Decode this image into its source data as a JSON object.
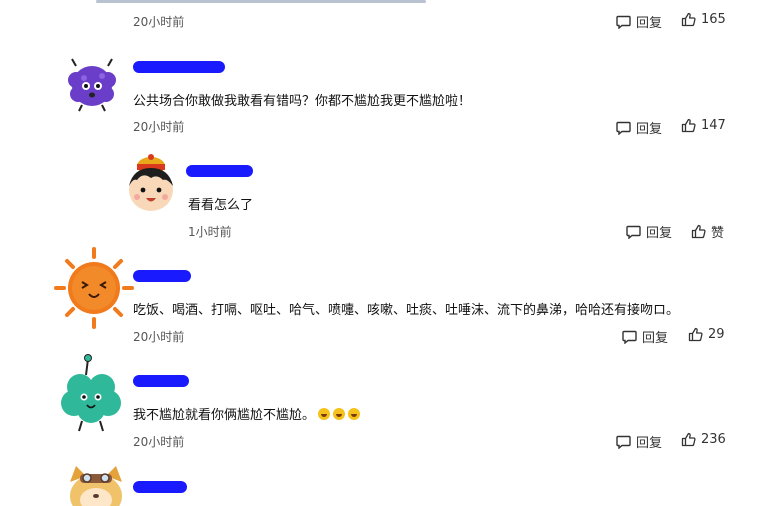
{
  "comments": [
    {
      "time": "20小时前",
      "reply_label": "回复",
      "likes": "165"
    },
    {
      "text": "公共场合你敢做我敢看有错吗？你都不尴尬我更不尴尬啦！",
      "time": "20小时前",
      "reply_label": "回复",
      "likes": "147"
    },
    {
      "text": "看看怎么了",
      "time": "1小时前",
      "reply_label": "回复",
      "likes": "赞"
    },
    {
      "text": "吃饭、喝酒、打嗝、呕吐、哈气、喷嚏、咳嗽、吐痰、吐唾沫、流下的鼻涕，哈哈还有接吻ロ。",
      "time": "20小时前",
      "reply_label": "回复",
      "likes": "29"
    },
    {
      "text": "我不尴尬就看你俩尴尬不尴尬。",
      "time": "20小时前",
      "reply_label": "回复",
      "likes": "236"
    }
  ],
  "icons": {
    "reply": "comment-bubble-icon",
    "like": "thumbs-up-icon"
  },
  "colors": {
    "redaction": "#1a1aff",
    "sun": "#f07a1c",
    "purple_monster": "#6a3ec8",
    "green_monster": "#2fb89a"
  }
}
